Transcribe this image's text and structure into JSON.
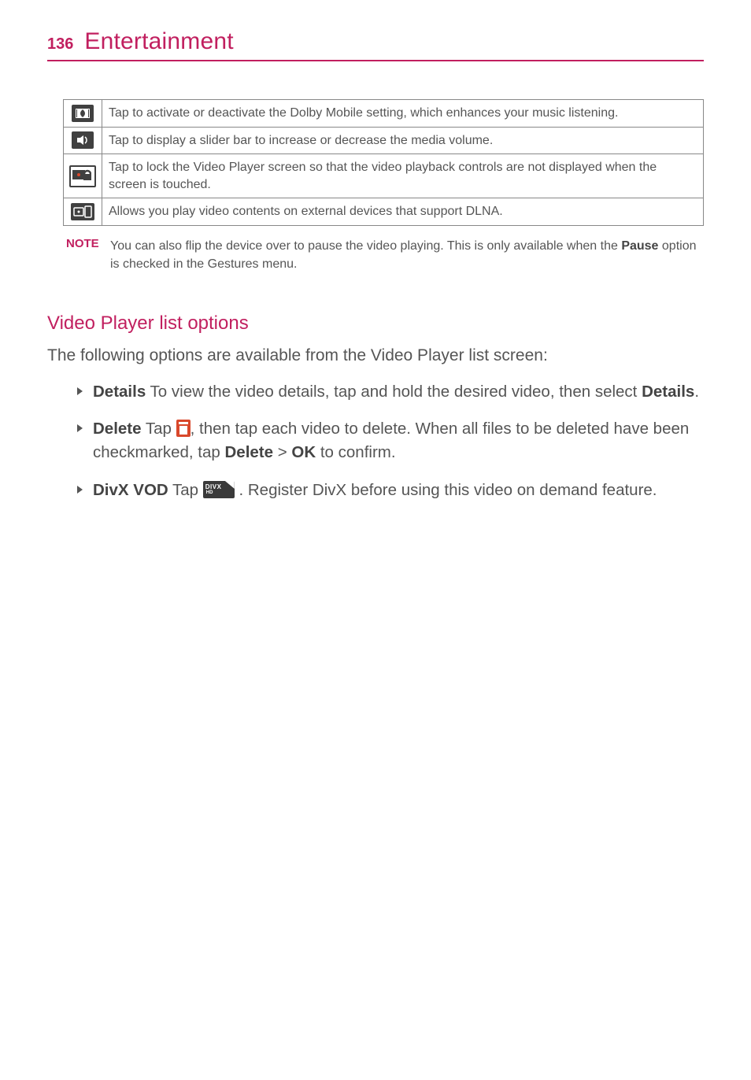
{
  "header": {
    "page_number": "136",
    "section": "Entertainment"
  },
  "icon_table": {
    "rows": [
      {
        "icon": "dolby",
        "desc": "Tap to activate or deactivate the Dolby Mobile setting, which enhances your music listening."
      },
      {
        "icon": "volume",
        "desc": "Tap to display a slider bar to increase or decrease the media volume."
      },
      {
        "icon": "lock",
        "desc": "Tap to lock the Video Player screen so that the video playback controls are not displayed when the screen is touched."
      },
      {
        "icon": "dlna",
        "desc": "Allows you play video contents on external devices that support DLNA."
      }
    ]
  },
  "note": {
    "label": "NOTE",
    "text_part1": "You can also flip the device over to pause the video playing. This is only available when the ",
    "text_bold": "Pause",
    "text_part2": " option is checked in the Gestures menu."
  },
  "subsection": {
    "title": "Video Player list options",
    "intro": "The following options are available from the Video Player list screen:",
    "items": {
      "details": {
        "label": "Details",
        "pre": "  To view the video details, tap and hold the desired video, then select ",
        "bold1": "Details",
        "post": "."
      },
      "delete": {
        "label": "Delete",
        "pre": "  Tap ",
        "mid": ", then tap each video to delete. When all files to be deleted have been checkmarked, tap ",
        "bold1": "Delete",
        "sep": " > ",
        "bold2": "OK",
        "post": " to confirm."
      },
      "divx": {
        "label": "DivX VOD",
        "pre": "  Tap ",
        "mid": " . Register DivX before using this video on demand feature."
      }
    }
  }
}
